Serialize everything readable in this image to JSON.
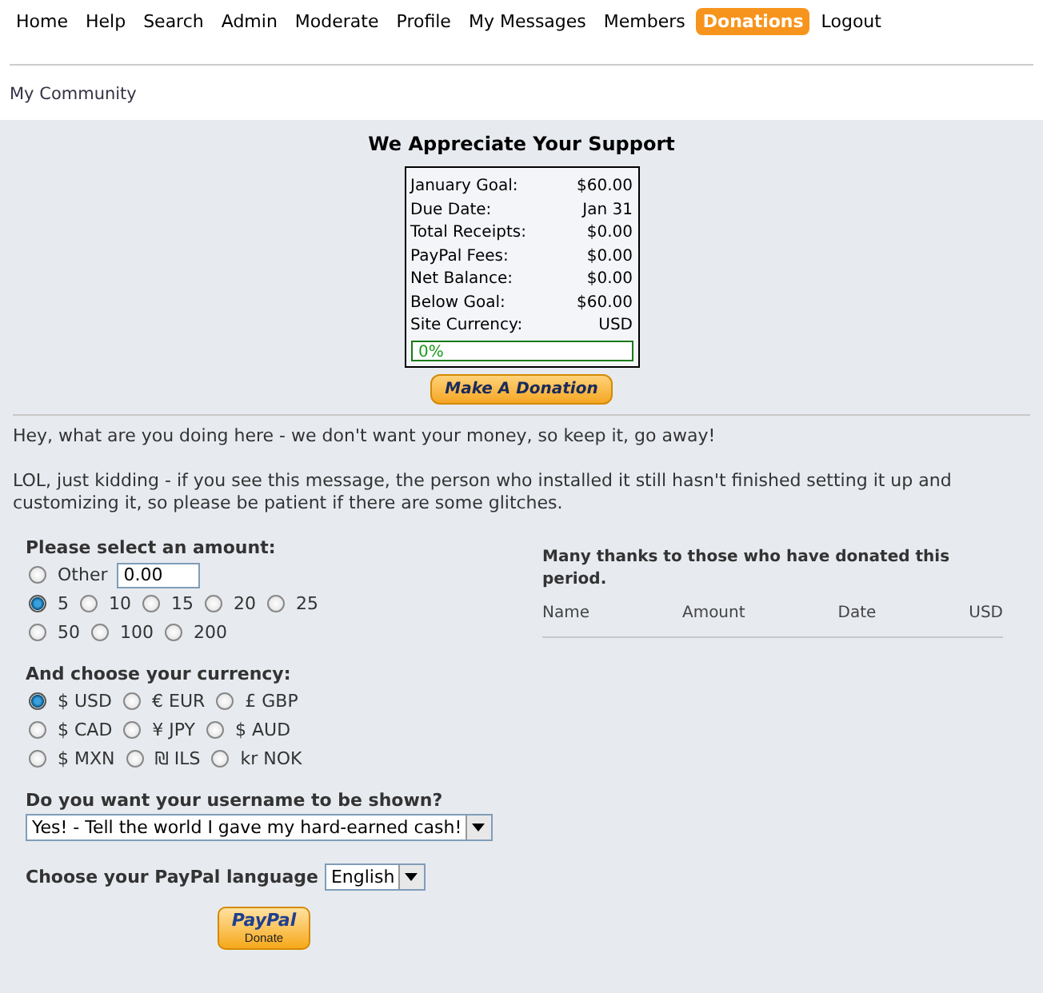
{
  "nav": [
    {
      "label": "Home",
      "selected": false
    },
    {
      "label": "Help",
      "selected": false
    },
    {
      "label": "Search",
      "selected": false
    },
    {
      "label": "Admin",
      "selected": false
    },
    {
      "label": "Moderate",
      "selected": false
    },
    {
      "label": "Profile",
      "selected": false
    },
    {
      "label": "My Messages",
      "selected": false
    },
    {
      "label": "Members",
      "selected": false
    },
    {
      "label": "Donations",
      "selected": true
    },
    {
      "label": "Logout",
      "selected": false
    }
  ],
  "breadcrumb": "My Community",
  "title": "We Appreciate Your Support",
  "summary": [
    {
      "label": "January Goal:",
      "value": "$60.00"
    },
    {
      "label": "Due Date:",
      "value": "Jan 31"
    },
    {
      "label": "Total Receipts:",
      "value": "$0.00"
    },
    {
      "label": "PayPal Fees:",
      "value": "$0.00"
    },
    {
      "label": "Net Balance:",
      "value": "$0.00"
    },
    {
      "label": "Below Goal:",
      "value": "$60.00"
    },
    {
      "label": "Site Currency:",
      "value": "USD"
    }
  ],
  "progress": {
    "level": 0,
    "label": "0%"
  },
  "donate_button": "Make A Donation",
  "messages": [
    "Hey, what are you doing here - we don't want your money, so keep it, go away!",
    "LOL, just kidding - if you see this message, the person who installed it still hasn't finished setting it up and customizing it, so please be patient if there are some glitches."
  ],
  "amount": {
    "heading": "Please select an amount:",
    "rows": [
      {
        "options": [
          {
            "label": "Other",
            "selected": false,
            "value": "0.00"
          }
        ]
      },
      {
        "options": [
          {
            "label": "5",
            "selected": true
          },
          {
            "label": "10",
            "selected": false
          },
          {
            "label": "15",
            "selected": false
          },
          {
            "label": "20",
            "selected": false
          },
          {
            "label": "25",
            "selected": false
          }
        ]
      },
      {
        "options": [
          {
            "label": "50",
            "selected": false
          },
          {
            "label": "100",
            "selected": false
          },
          {
            "label": "200",
            "selected": false
          }
        ]
      }
    ]
  },
  "currency": {
    "heading": "And choose your currency:",
    "rows": [
      {
        "options": [
          {
            "label": "$ USD",
            "selected": true
          },
          {
            "label": "€ EUR",
            "selected": false
          },
          {
            "label": "£ GBP",
            "selected": false
          }
        ]
      },
      {
        "options": [
          {
            "label": "$ CAD",
            "selected": false
          },
          {
            "label": "¥ JPY",
            "selected": false
          },
          {
            "label": "$ AUD",
            "selected": false
          }
        ]
      },
      {
        "options": [
          {
            "label": "$ MXN",
            "selected": false
          },
          {
            "label": "₪ ILS",
            "selected": false
          },
          {
            "label": "kr NOK",
            "selected": false
          }
        ]
      }
    ]
  },
  "show_username": {
    "label": "Do you want your username to be shown?",
    "value": "Yes! - Tell the world I gave my hard-earned cash!"
  },
  "language": {
    "label": "Choose your PayPal language",
    "value": "English"
  },
  "paypal_button": {
    "brand": "PayPal",
    "label": "Donate"
  },
  "donors": {
    "heading": "Many thanks to those who have donated this period.",
    "columns": [
      "Name",
      "Amount",
      "Date",
      "USD"
    ]
  }
}
